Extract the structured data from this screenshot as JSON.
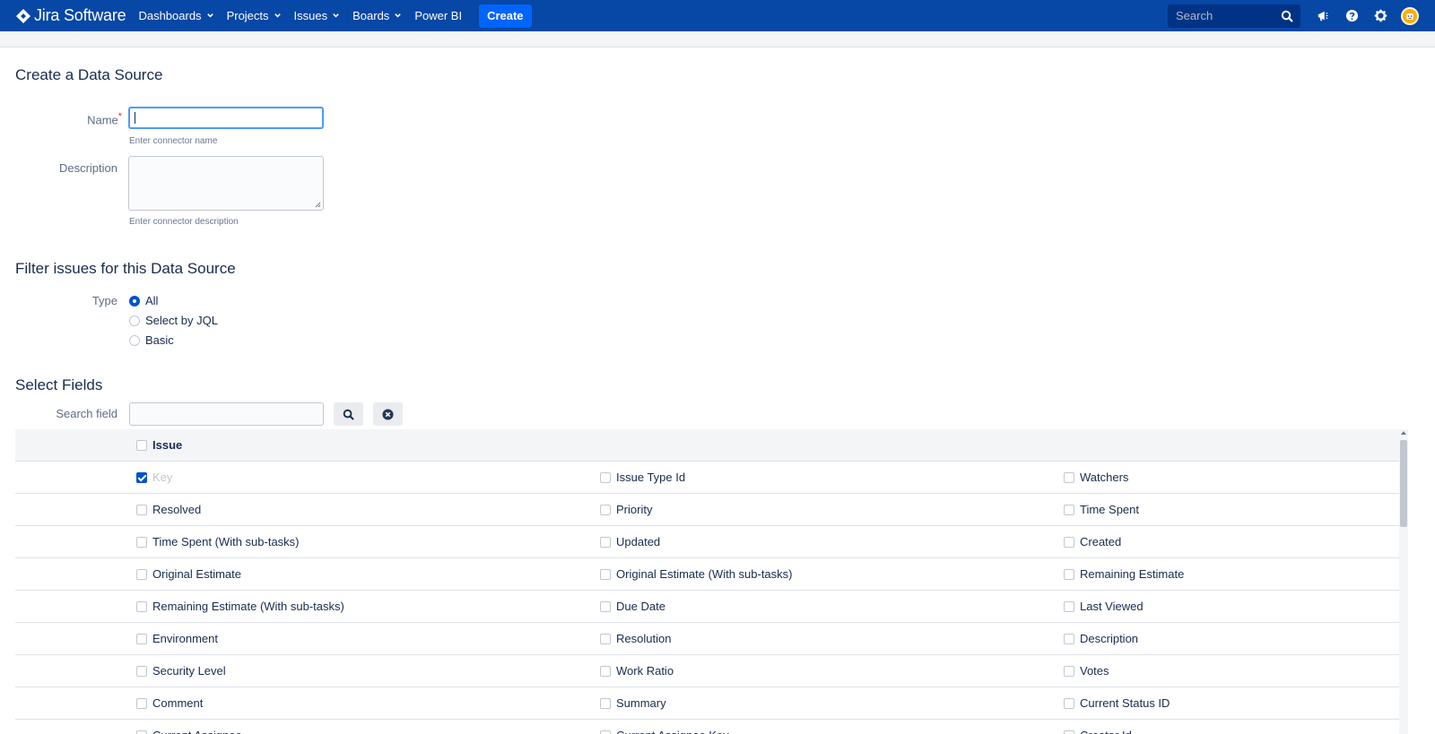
{
  "nav": {
    "brand": "Jira Software",
    "items": [
      {
        "label": "Dashboards",
        "has_dropdown": true
      },
      {
        "label": "Projects",
        "has_dropdown": true
      },
      {
        "label": "Issues",
        "has_dropdown": true
      },
      {
        "label": "Boards",
        "has_dropdown": true
      },
      {
        "label": "Power BI",
        "has_dropdown": false
      }
    ],
    "create_label": "Create",
    "search_placeholder": "Search",
    "icons": [
      "megaphone-icon",
      "help-icon",
      "settings-icon",
      "avatar"
    ],
    "colors": {
      "nav_bg": "#0747a6",
      "create_bg": "#0065ff"
    }
  },
  "form": {
    "title": "Create a Data Source",
    "name_label": "Name",
    "name_required_mark": "*",
    "name_value": "",
    "name_hint": "Enter connector name",
    "description_label": "Description",
    "description_value": "",
    "description_hint": "Enter connector description"
  },
  "filter": {
    "title": "Filter issues for this Data Source",
    "type_label": "Type",
    "options": [
      {
        "label": "All",
        "selected": true
      },
      {
        "label": "Select by JQL",
        "selected": false
      },
      {
        "label": "Basic",
        "selected": false
      }
    ]
  },
  "fields": {
    "title": "Select Fields",
    "search_label": "Search field",
    "search_value": "",
    "group_header": "Issue",
    "rows": [
      [
        {
          "label": "Key",
          "checked": true,
          "disabled": true
        },
        {
          "label": "Issue Type Id",
          "checked": false
        },
        {
          "label": "Watchers",
          "checked": false
        }
      ],
      [
        {
          "label": "Resolved",
          "checked": false
        },
        {
          "label": "Priority",
          "checked": false
        },
        {
          "label": "Time Spent",
          "checked": false
        }
      ],
      [
        {
          "label": "Time Spent (With sub-tasks)",
          "checked": false
        },
        {
          "label": "Updated",
          "checked": false
        },
        {
          "label": "Created",
          "checked": false
        }
      ],
      [
        {
          "label": "Original Estimate",
          "checked": false
        },
        {
          "label": "Original Estimate (With sub-tasks)",
          "checked": false
        },
        {
          "label": "Remaining Estimate",
          "checked": false
        }
      ],
      [
        {
          "label": "Remaining Estimate (With sub-tasks)",
          "checked": false
        },
        {
          "label": "Due Date",
          "checked": false
        },
        {
          "label": "Last Viewed",
          "checked": false
        }
      ],
      [
        {
          "label": "Environment",
          "checked": false
        },
        {
          "label": "Resolution",
          "checked": false
        },
        {
          "label": "Description",
          "checked": false
        }
      ],
      [
        {
          "label": "Security Level",
          "checked": false
        },
        {
          "label": "Work Ratio",
          "checked": false
        },
        {
          "label": "Votes",
          "checked": false
        }
      ],
      [
        {
          "label": "Comment",
          "checked": false
        },
        {
          "label": "Summary",
          "checked": false
        },
        {
          "label": "Current Status ID",
          "checked": false
        }
      ],
      [
        {
          "label": "Current Assignee",
          "checked": false
        },
        {
          "label": "Current Assignee Key",
          "checked": false
        },
        {
          "label": "Creator Id",
          "checked": false
        }
      ]
    ]
  }
}
